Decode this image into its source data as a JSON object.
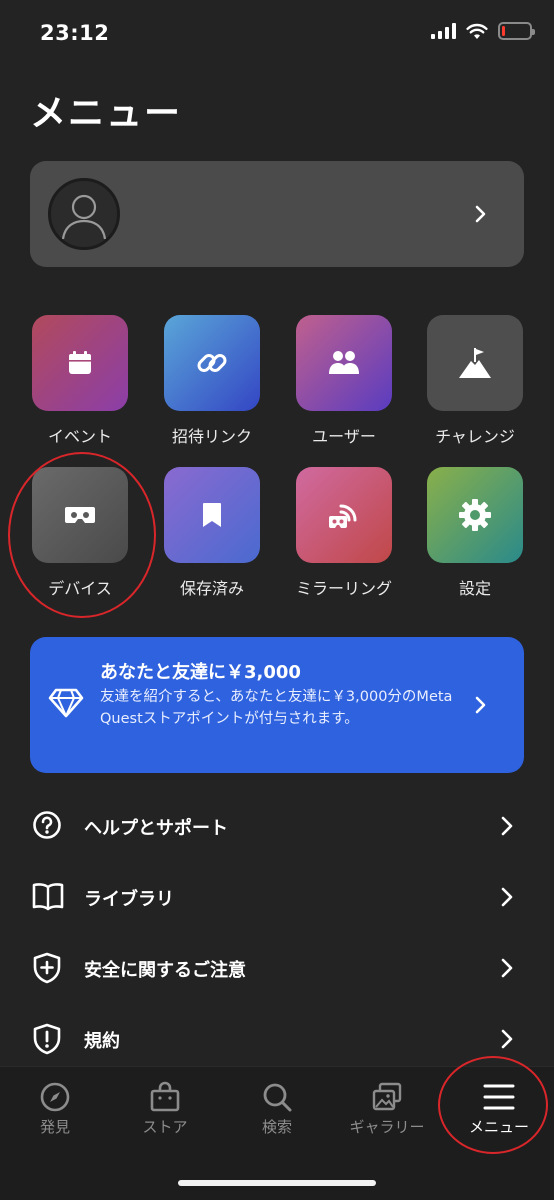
{
  "status": {
    "time": "23:12",
    "battery_level": 0.1,
    "battery_color": "#ff3b30"
  },
  "page": {
    "title": "メニュー"
  },
  "profile": {
    "avatar_icon": "person-icon",
    "chevron_icon": "chevron-right-icon"
  },
  "tiles": [
    {
      "label": "イベント",
      "icon": "calendar-icon",
      "gradient": [
        "#b24a5c",
        "#8b3ea8"
      ]
    },
    {
      "label": "招待リンク",
      "icon": "link-icon",
      "gradient": [
        "#5aa6d8",
        "#3446c4"
      ]
    },
    {
      "label": "ユーザー",
      "icon": "users-icon",
      "gradient": [
        "#c0608e",
        "#5a3cc0"
      ]
    },
    {
      "label": "チャレンジ",
      "icon": "flag-mountain-icon",
      "gradient": [
        "#4e4e4e",
        "#4e4e4e"
      ]
    },
    {
      "label": "デバイス",
      "icon": "headset-icon",
      "gradient": [
        "#6a6a6a",
        "#4a4a4a"
      ]
    },
    {
      "label": "保存済み",
      "icon": "bookmark-icon",
      "gradient": [
        "#8a6ad0",
        "#4a6ad0"
      ]
    },
    {
      "label": "ミラーリング",
      "icon": "cast-icon",
      "gradient": [
        "#d06aa0",
        "#c04848"
      ]
    },
    {
      "label": "設定",
      "icon": "gear-icon",
      "gradient": [
        "#8ab04a",
        "#2a8a8a"
      ]
    }
  ],
  "promo": {
    "title": "あなたと友達に￥3,000",
    "body": "友達を紹介すると、あなたと友達に￥3,000分のMeta Questストアポイントが付与されます。",
    "icon": "diamond-icon",
    "color": "#2f62de"
  },
  "menu_items": [
    {
      "label": "ヘルプとサポート",
      "icon": "question-circle-icon"
    },
    {
      "label": "ライブラリ",
      "icon": "book-icon"
    },
    {
      "label": "安全に関するご注意",
      "icon": "shield-plus-icon"
    },
    {
      "label": "規約",
      "icon": "shield-alert-icon"
    }
  ],
  "bottom_nav": [
    {
      "label": "発見",
      "icon": "compass-icon",
      "active": false
    },
    {
      "label": "ストア",
      "icon": "shopping-bag-icon",
      "active": false
    },
    {
      "label": "検索",
      "icon": "search-icon",
      "active": false
    },
    {
      "label": "ギャラリー",
      "icon": "gallery-icon",
      "active": false
    },
    {
      "label": "メニュー",
      "icon": "hamburger-menu-icon",
      "active": true
    }
  ],
  "annotation_color": "#d9262a"
}
